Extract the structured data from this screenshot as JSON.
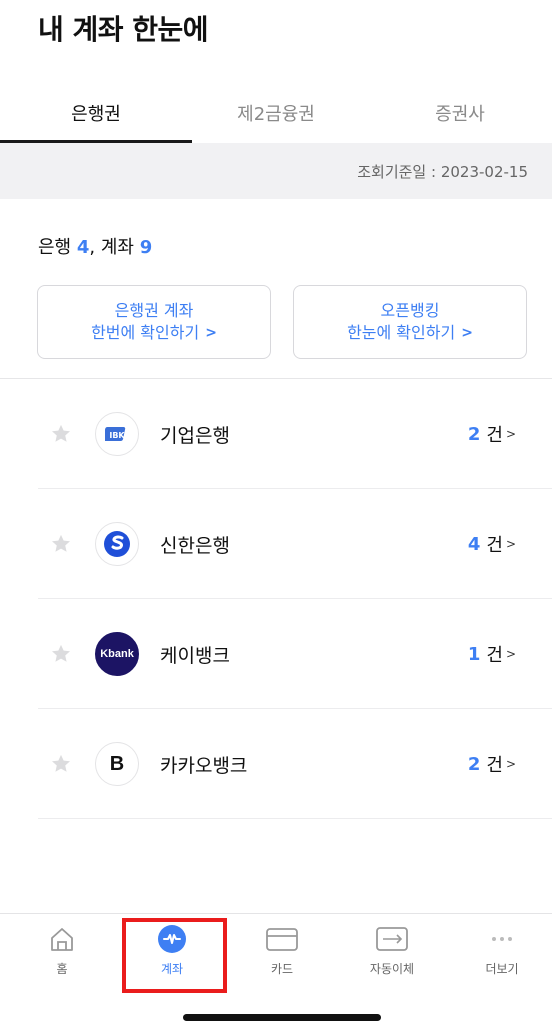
{
  "page": {
    "title": "내 계좌 한눈에"
  },
  "tabs": [
    {
      "label": "은행권",
      "active": true
    },
    {
      "label": "제2금융권",
      "active": false
    },
    {
      "label": "증권사",
      "active": false
    }
  ],
  "query_date": "조회기준일 : 2023-02-15",
  "summary": {
    "bank_label": "은행",
    "bank_count": "4",
    "sep": ", 계좌",
    "account_count": "9"
  },
  "buttons": {
    "bank_accounts": {
      "line1": "은행권 계좌",
      "line2": "한번에 확인하기"
    },
    "open_banking": {
      "line1": "오픈뱅킹",
      "line2": "한눈에 확인하기"
    }
  },
  "banks": [
    {
      "name": "기업은행",
      "count": "2",
      "unit": "건",
      "logo": "ibk-logo"
    },
    {
      "name": "신한은행",
      "count": "4",
      "unit": "건",
      "logo": "shinhan-logo"
    },
    {
      "name": "케이뱅크",
      "count": "1",
      "unit": "건",
      "logo": "kbank-logo",
      "logo_text": "Kbank"
    },
    {
      "name": "카카오뱅크",
      "count": "2",
      "unit": "건",
      "logo": "kakaobank-logo",
      "logo_text": "B"
    }
  ],
  "tabbar": [
    {
      "label": "홈",
      "icon": "home-icon"
    },
    {
      "label": "계좌",
      "icon": "account-icon",
      "active": true
    },
    {
      "label": "카드",
      "icon": "card-icon"
    },
    {
      "label": "자동이체",
      "icon": "auto-transfer-icon"
    },
    {
      "label": "더보기",
      "icon": "more-icon"
    }
  ],
  "colors": {
    "accent": "#3e7ff3",
    "highlight": "#ea1c1c"
  }
}
